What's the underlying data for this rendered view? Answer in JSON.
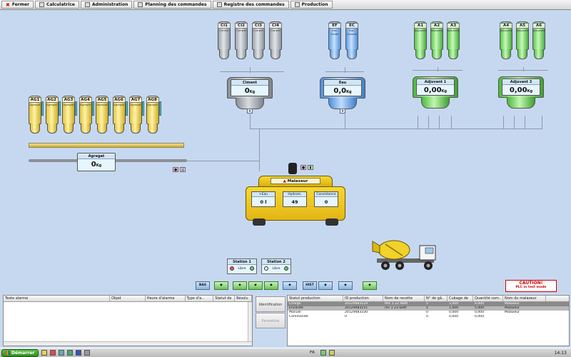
{
  "menu": {
    "items": [
      {
        "label": "Fermer",
        "name": "menu-fermer"
      },
      {
        "label": "Calculatrice",
        "name": "menu-calculatrice"
      },
      {
        "label": "Administration",
        "name": "menu-administration"
      },
      {
        "label": "Planning des commandes",
        "name": "menu-planning"
      },
      {
        "label": "Registre des commandes",
        "name": "menu-registre"
      },
      {
        "label": "Production",
        "name": "menu-production"
      }
    ]
  },
  "silos": {
    "cement": [
      {
        "id": "CI1",
        "sub": "Ciment"
      },
      {
        "id": "CI2",
        "sub": "Ciment"
      },
      {
        "id": "CI3",
        "sub": "Ciment"
      },
      {
        "id": "CI4",
        "sub": "Ciment"
      }
    ],
    "water": [
      {
        "id": "EF",
        "sub": "Eau froide"
      },
      {
        "id": "EC",
        "sub": "Eau chaude"
      }
    ],
    "adj1": [
      {
        "id": "A1",
        "sub": "Adjuvant"
      },
      {
        "id": "A2",
        "sub": "Adjuvant"
      },
      {
        "id": "A3",
        "sub": "Adjuvant"
      }
    ],
    "adj2": [
      {
        "id": "A4",
        "sub": "Adjuvant"
      },
      {
        "id": "A5",
        "sub": "Adjuvant"
      },
      {
        "id": "A6",
        "sub": "Adjuvant"
      }
    ],
    "aggregates": [
      {
        "id": "AG1",
        "sub": "Agregat"
      },
      {
        "id": "AG2",
        "sub": "Agregat"
      },
      {
        "id": "AG3",
        "sub": "Agregat"
      },
      {
        "id": "AG4",
        "sub": "Agregat"
      },
      {
        "id": "AG5",
        "sub": "Agregat"
      },
      {
        "id": "AG6",
        "sub": "Agregat"
      },
      {
        "id": "AG7",
        "sub": "Agregat"
      },
      {
        "id": "AG8",
        "sub": "Agregat"
      }
    ]
  },
  "scales": {
    "ciment": {
      "title": "Ciment",
      "value": "0",
      "unit": "Kg"
    },
    "eau": {
      "title": "Eau",
      "value": "0,0",
      "unit": "Kg"
    },
    "adj1": {
      "title": "Adjuvant 1",
      "value": "0,00",
      "unit": "Kg"
    },
    "adj3": {
      "title": "Adjuvant 3",
      "value": "0,00",
      "unit": "Kg"
    },
    "agregat": {
      "title": "Agregat",
      "value": "0",
      "unit": "Kg"
    }
  },
  "mixer": {
    "title": "Malaxeur",
    "cells": [
      {
        "title": "+Eau",
        "value": "0  l"
      },
      {
        "title": "Hydrom.",
        "value": "49"
      },
      {
        "title": "Consistance",
        "value": "0"
      }
    ]
  },
  "stations": [
    {
      "title": "Station 1",
      "status": "Libre"
    },
    {
      "title": "Station 2",
      "status": "Libre"
    }
  ],
  "toolbar": {
    "buttons": [
      "BAS",
      "",
      "",
      "",
      "",
      "",
      "",
      "HIST",
      "",
      "",
      ""
    ]
  },
  "caution": {
    "line1": "CAUTION!",
    "line2": "PLC in test mode"
  },
  "alarms": {
    "columns": [
      "Texte alarme",
      "Objet",
      "Heure d'alarme",
      "Type d'a..",
      "Statut de",
      "Résolu"
    ]
  },
  "side_buttons": {
    "identification": "Identification",
    "permettre": "Permettre"
  },
  "production": {
    "columns": [
      "Statut production",
      "ID production",
      "Nom de recette",
      "N° de gâ..",
      "Cubage de",
      "Quantité com..",
      "Nom du malaxeur"
    ],
    "rows": [
      {
        "statut": "Charge",
        "id": "20129483124",
        "recette": "Rec 1 22 Watt",
        "n": "5",
        "cubage": "1,000",
        "qte": "6,000",
        "malaxeur": "Malaxeur",
        "style": "sel"
      },
      {
        "statut": "Enceinte",
        "id": "20129483151",
        "recette": "rec 1 23 watt",
        "n": "5",
        "cubage": "1,000",
        "qte": "5,000",
        "malaxeur": "Malaxeur",
        "style": "sel2"
      },
      {
        "statut": "Manuel",
        "id": "20129483330",
        "recette": "",
        "n": "0",
        "cubage": "0,000",
        "qte": "0,000",
        "malaxeur": "Malaxeur",
        "style": ""
      },
      {
        "statut": "Commandé",
        "id": "0",
        "recette": "",
        "n": "0",
        "cubage": "0,000",
        "qte": "0,000",
        "malaxeur": "",
        "style": ""
      }
    ]
  },
  "taskbar": {
    "start": "Démarrer",
    "lang": "FR",
    "clock": "14:13"
  },
  "colors": {
    "canvas": "#c6d8f0",
    "cement": "#b9bfc6",
    "water": "#7fb6f0",
    "adjuvant": "#7ad86a",
    "aggregate": "#f1d55b",
    "mixer": "#f3cf22"
  }
}
